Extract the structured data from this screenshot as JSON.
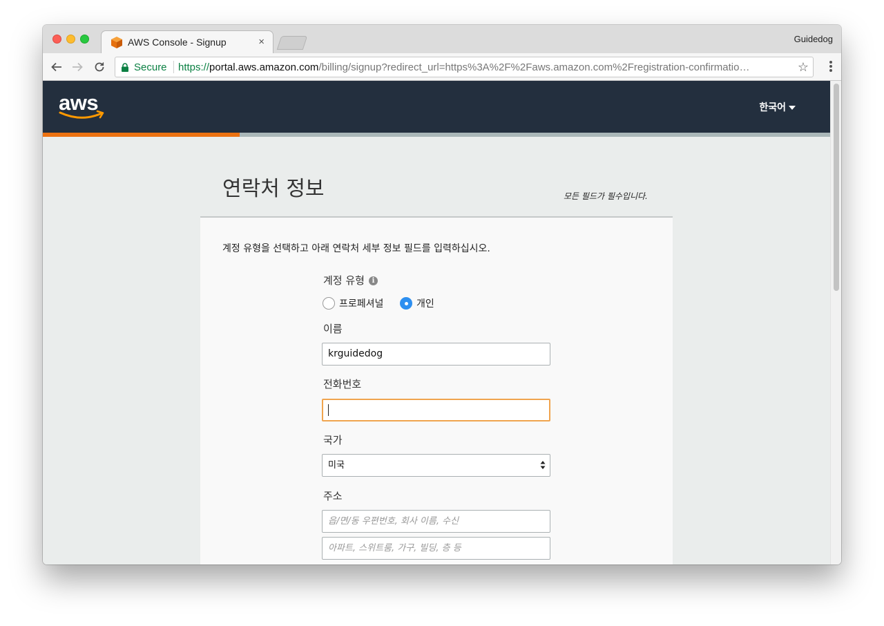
{
  "browser": {
    "tab_title": "AWS Console - Signup",
    "tab_close": "×",
    "profile_name": "Guidedog",
    "secure_label": "Secure",
    "url_scheme": "https://",
    "url_host": "portal.aws.amazon.com",
    "url_path": "/billing/signup?redirect_url=https%3A%2F%2Faws.amazon.com%2Fregistration-confirmatio…",
    "star": "☆"
  },
  "header": {
    "logo_text": "aws",
    "language": "한국어",
    "progress": 0.25
  },
  "page": {
    "title": "연락처 정보",
    "required_note": "모든 필드가 필수입니다.",
    "intro": "계정 유형을 선택하고 아래 연락처 세부 정보 필드를 입력하십시오."
  },
  "form": {
    "account_type_label": "계정 유형",
    "info_icon": "i",
    "radio_professional": "프로페셔널",
    "radio_personal": "개인",
    "selected_account_type": "personal",
    "name_label": "이름",
    "name_value": "krguidedog",
    "phone_label": "전화번호",
    "phone_value": "",
    "country_label": "국가",
    "country_value": "미국",
    "address_label": "주소",
    "address1_placeholder": "읍/면/동 우편번호, 회사 이름, 수신",
    "address2_placeholder": "아파트, 스위트룸, 가구, 빌딩, 층 등"
  },
  "colors": {
    "header_bg": "#232f3e",
    "accent_orange": "#ec7211",
    "radio_blue": "#2d8ff0",
    "focus_orange": "#f0a44e"
  }
}
